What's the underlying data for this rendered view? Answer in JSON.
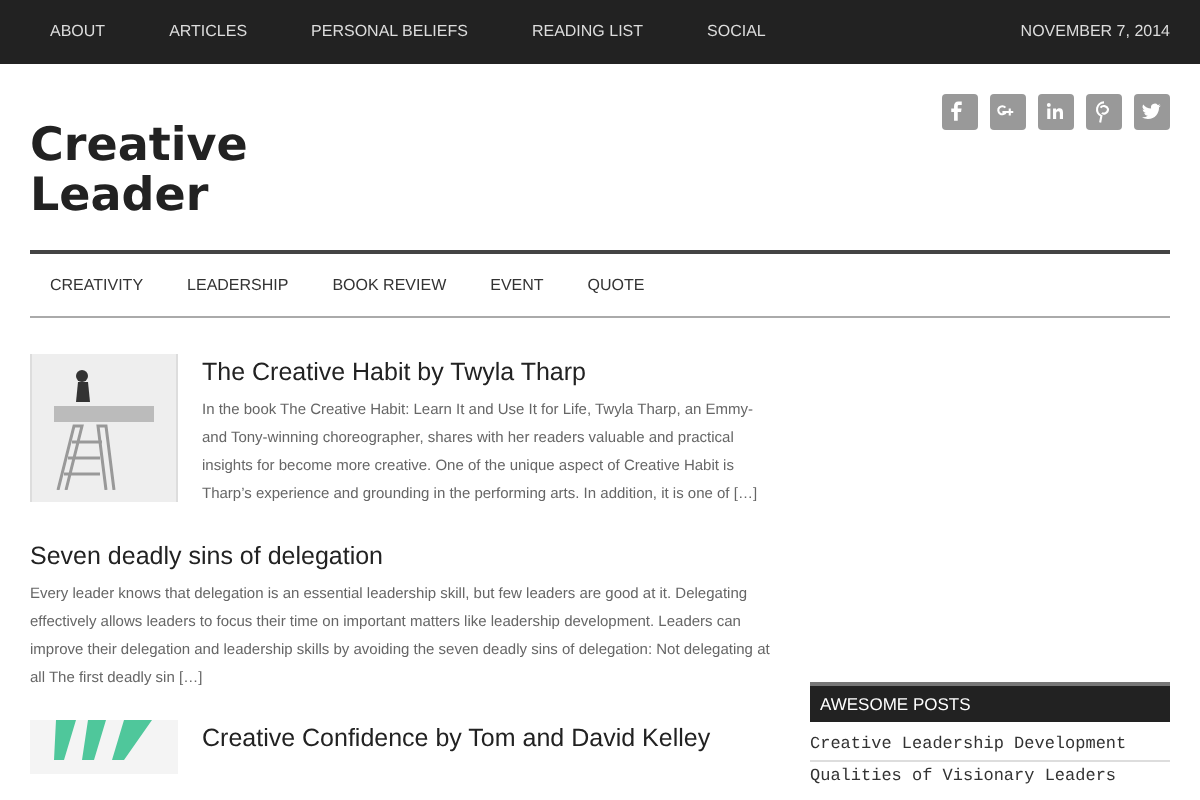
{
  "top_nav": {
    "items": [
      {
        "label": "ABOUT"
      },
      {
        "label": "ARTICLES"
      },
      {
        "label": "PERSONAL BELIEFS"
      },
      {
        "label": "READING LIST"
      },
      {
        "label": "SOCIAL"
      }
    ],
    "date": "NOVEMBER 7, 2014"
  },
  "header": {
    "title": "Creative Leader",
    "social": [
      {
        "kind": "facebook"
      },
      {
        "kind": "googleplus"
      },
      {
        "kind": "linkedin"
      },
      {
        "kind": "pinterest"
      },
      {
        "kind": "twitter"
      }
    ]
  },
  "category_nav": [
    {
      "label": "CREATIVITY"
    },
    {
      "label": "LEADERSHIP"
    },
    {
      "label": "BOOK REVIEW"
    },
    {
      "label": "EVENT"
    },
    {
      "label": "QUOTE"
    }
  ],
  "posts": [
    {
      "kind": "book",
      "title": "The Creative Habit by Twyla Tharp",
      "excerpt": "In the book The Creative Habit: Learn It and Use It for Life, Twyla Tharp, an Emmy- and Tony-winning choreographer, shares with her readers valuable and practical insights for become more creative.  One of the unique aspect of Creative Habit is Tharp’s experience and grounding in the performing arts.    In addition, it is one of […]"
    },
    {
      "kind": "text",
      "title": "Seven deadly sins of delegation",
      "excerpt": "Every leader knows that delegation is an essential leadership skill, but few leaders are good at it. Delegating effectively allows leaders to focus their time on important matters like leadership development.  Leaders can improve their delegation and leadership skills by avoiding the seven deadly sins of delegation: Not delegating at all The first deadly sin […]"
    },
    {
      "kind": "book",
      "title": "Creative Confidence by Tom and David Kelley"
    }
  ],
  "sidebar": {
    "heading": "AWESOME POSTS",
    "links": [
      "Creative Leadership Development",
      "Qualities of Visionary Leaders"
    ]
  }
}
